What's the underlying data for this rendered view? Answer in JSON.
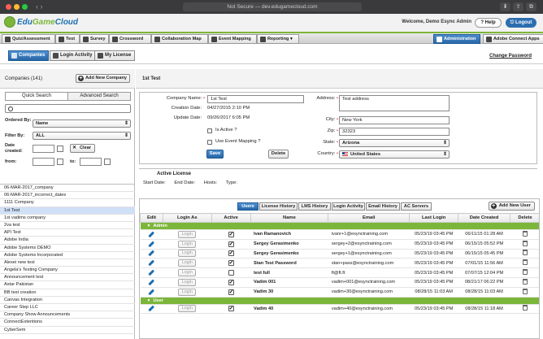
{
  "browser": {
    "address": "Not Secure — dev.edugamecloud.com"
  },
  "header": {
    "logo_text_a": "Edu",
    "logo_text_b": "Game",
    "logo_text_c": "Cloud",
    "welcome": "Welcome, Demo Esync Admin",
    "help_label": "Help",
    "logout_label": "Logout"
  },
  "menu": {
    "items": [
      "Quiz/Assessment",
      "Test",
      "Survey",
      "Crossword",
      "Collaboration Map",
      "Event Mapping",
      "Reporting"
    ],
    "admin_label": "Administration",
    "adobe_label": "Adobe Connect Apps"
  },
  "subnav": {
    "tabs": [
      "Companies",
      "Login Activity",
      "My License"
    ],
    "change_password": "Change Password"
  },
  "left": {
    "title": "Companies (141)",
    "add_button": "Add New Company",
    "search_tabs": [
      "Quick Search",
      "Advanced Search"
    ],
    "ordered_by_label": "Ordered By:",
    "ordered_by_value": "Name",
    "filter_by_label": "Filter By:",
    "filter_by_value": "ALL",
    "date_created_label": "Date created:",
    "from_label": "from:",
    "to_label": "to:",
    "clear_label": "Clear",
    "companies": [
      "06-MAR-2017_company",
      "06-MAR-2017_incorrect_dates",
      "1111 Company",
      "1st Test",
      "1st vadims company",
      "2va test",
      "API Test",
      "Adobe India",
      "Adobe Systems DEMO",
      "Adobe Systems Incorporated",
      "Alexei new test",
      "Angela's Testing Company",
      "Announcement test",
      "Astar Pakistan",
      "BB test creation",
      "Canvas Integration",
      "Career Step LLC",
      "Company Show Announcements",
      "ConnectExtentions",
      "CyberSem"
    ],
    "selected_index": 3
  },
  "company": {
    "heading": "1st Test",
    "name_label": "Company Name:",
    "name_value": "1st Test",
    "creation_label": "Creation Date:",
    "creation_value": "04/27/2015 2:10 PM",
    "update_label": "Update Date:",
    "update_value": "09/26/2017 6:05 PM",
    "active_label": "Is Active ?",
    "event_label": "Use Event Mapping ?",
    "save_label": "Save",
    "delete_label": "Delete",
    "address_label": "Address:",
    "address_value": "Test address",
    "city_label": "City:",
    "city_value": "New York",
    "zip_label": "Zip:",
    "zip_value": "32323",
    "state_label": "State:",
    "state_value": "Arizona",
    "country_label": "Country:",
    "country_value": "United States"
  },
  "license": {
    "title": "Active License",
    "fields": [
      "Start Date:",
      "End Date:",
      "Hosts:",
      "Type:"
    ]
  },
  "users": {
    "tabs": [
      "Users",
      "License History",
      "LMS History",
      "Login Activity",
      "Email History",
      "AC Servers"
    ],
    "add_label": "Add New User",
    "columns": [
      "Edit",
      "Login As",
      "Active",
      "Name",
      "Email",
      "Last Login",
      "Date Created",
      "Delete"
    ],
    "login_label": "Login",
    "groups": [
      {
        "name": "Admin",
        "rows": [
          {
            "active": true,
            "name": "Ivan Ramanovich",
            "email": "ivanr+1@esynctraining.com",
            "last_login": "05/23/19 03:45 PM",
            "created": "06/11/15 01:28 AM"
          },
          {
            "active": true,
            "name": "Sergey Gerasimenko",
            "email": "sergey+2@esynctraining.com",
            "last_login": "05/23/19 03:45 PM",
            "created": "06/15/15 05:52 PM"
          },
          {
            "active": true,
            "name": "Sergey Gerasimenko",
            "email": "sergey+1@esynctraining.com",
            "last_login": "05/23/19 03:45 PM",
            "created": "06/15/15 05:45 PM"
          },
          {
            "active": true,
            "name": "Stan Test Password",
            "email": "stan+pass@esynctraining.com",
            "last_login": "05/23/19 03:45 PM",
            "created": "07/01/15 11:56 AM"
          },
          {
            "active": false,
            "name": "test full",
            "email": "ft@ft.ft",
            "last_login": "05/23/19 03:45 PM",
            "created": "07/07/15 12:04 PM"
          },
          {
            "active": true,
            "name": "Vadim 001",
            "email": "vadim+001@esynctraining.com",
            "last_login": "05/23/19 03:45 PM",
            "created": "08/21/17 06:22 PM"
          },
          {
            "active": true,
            "name": "Vadim 30",
            "email": "vadim+30@esynctraining.com",
            "last_login": "08/28/15 11:03 AM",
            "created": "08/28/15 11:03 AM"
          }
        ]
      },
      {
        "name": "User",
        "rows": [
          {
            "active": true,
            "name": "Vadim 40",
            "email": "vadim+40@esynctraining.com",
            "last_login": "05/23/19 03:45 PM",
            "created": "08/28/15 11:18 AM"
          }
        ]
      }
    ]
  }
}
